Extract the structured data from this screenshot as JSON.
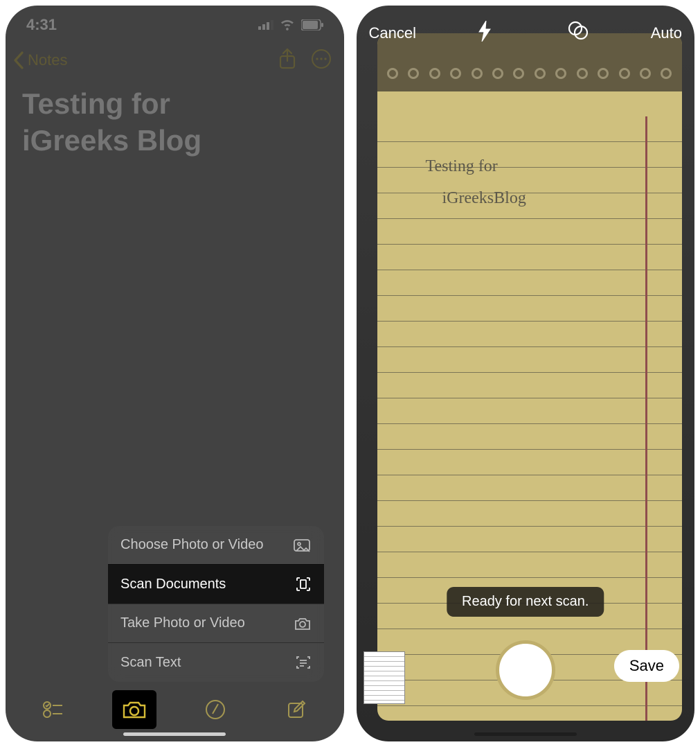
{
  "left": {
    "status_time": "4:31",
    "back_label": "Notes",
    "note_title_line1": "Testing for",
    "note_title_line2": "iGreeks Blog",
    "sheet": {
      "choose": "Choose Photo or Video",
      "scan_docs": "Scan Documents",
      "take": "Take Photo or Video",
      "scan_text": "Scan Text"
    }
  },
  "right": {
    "cancel": "Cancel",
    "auto": "Auto",
    "notepad_line1": "Testing for",
    "notepad_line2": "iGreeksBlog",
    "toast": "Ready for next scan.",
    "save": "Save"
  }
}
